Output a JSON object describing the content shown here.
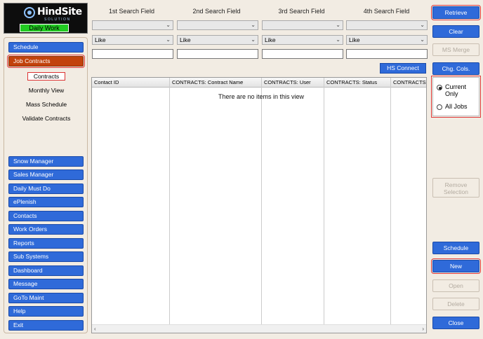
{
  "logo": {
    "name": "HindSite",
    "sub": "SOLUTION",
    "badge": "Daily Work"
  },
  "nav": {
    "top": [
      {
        "label": "Schedule",
        "active": false
      },
      {
        "label": "Job Contracts",
        "active": true
      }
    ],
    "sub_items": [
      {
        "label": "Contracts",
        "selected": true
      },
      {
        "label": "Monthly View",
        "selected": false
      },
      {
        "label": "Mass Schedule",
        "selected": false
      },
      {
        "label": "Validate Contracts",
        "selected": false
      }
    ],
    "bottom": [
      "Snow Manager",
      "Sales Manager",
      "Daily Must Do",
      "ePlenish",
      "Contacts",
      "Work Orders",
      "Reports",
      "Sub Systems",
      "Dashboard",
      "Message",
      "GoTo Maint",
      "Help",
      "Exit"
    ]
  },
  "search": {
    "fields": [
      {
        "header": "1st Search Field",
        "field": "",
        "operator": "Like",
        "value": ""
      },
      {
        "header": "2nd Search Field",
        "field": "",
        "operator": "Like",
        "value": ""
      },
      {
        "header": "3rd Search Field",
        "field": "",
        "operator": "Like",
        "value": ""
      },
      {
        "header": "4th Search Field",
        "field": "",
        "operator": "Like",
        "value": ""
      }
    ],
    "hs_connect": "HS Connect"
  },
  "grid": {
    "columns": [
      "Contact ID",
      "CONTRACTS: Contract Name",
      "CONTRACTS: User",
      "CONTRACTS: Status",
      "CONTRACTS: C"
    ],
    "empty_message": "There are no items in this view"
  },
  "actions": {
    "retrieve": "Retrieve",
    "clear": "Clear",
    "ms_merge": "MS Merge",
    "chg_cols": "Chg. Cols.",
    "remove_selection": "Remove Selection",
    "schedule": "Schedule",
    "new": "New",
    "open": "Open",
    "delete": "Delete",
    "close": "Close"
  },
  "filter": {
    "options": [
      {
        "label": "Current Only",
        "checked": true
      },
      {
        "label": "All Jobs",
        "checked": false
      }
    ]
  },
  "colors": {
    "accent": "#2f6ad9",
    "active": "#c2420c",
    "highlight": "#e03a3a"
  }
}
